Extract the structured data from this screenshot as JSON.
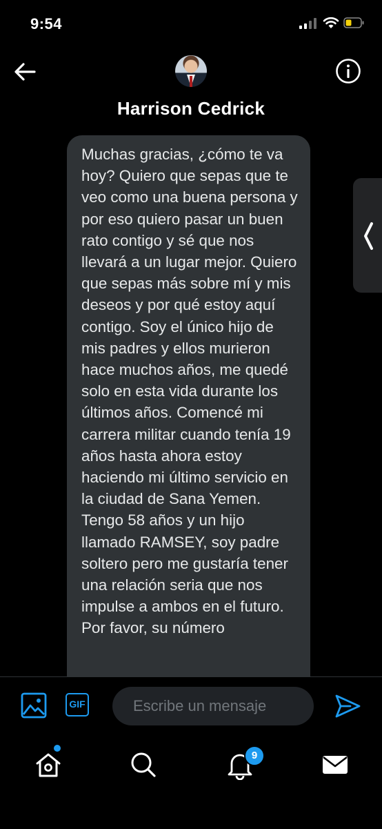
{
  "status_bar": {
    "time": "9:54",
    "icons": [
      "cellular-signal-icon",
      "wifi-icon",
      "battery-icon"
    ],
    "battery_color": "#f5d20a"
  },
  "header": {
    "back_icon": "arrow-left-icon",
    "contact_name": "Harrison Cedrick",
    "info_icon": "info-circle-icon"
  },
  "message": {
    "text": "Muchas gracias, ¿cómo te va hoy? Quiero que sepas que te veo como una buena persona y por eso quiero pasar un buen rato contigo y sé que nos llevará a un lugar mejor. Quiero que sepas más sobre mí y mis deseos y por qué estoy aquí contigo. Soy el único hijo de mis padres y ellos murieron hace muchos años, me quedé solo en esta vida durante los últimos años. Comencé mi carrera militar cuando tenía 19 años hasta ahora estoy haciendo mi último servicio en la ciudad de Sana Yemen. Tengo 58 años y un hijo llamado RAMSEY, soy padre soltero pero me gustaría tener una relación seria que nos impulse a ambos en el futuro. Por favor, su número"
  },
  "composer": {
    "gif_label": "GIF",
    "placeholder": "Escribe un mensaje",
    "value": ""
  },
  "tab_bar": {
    "notifications_count": "9"
  },
  "colors": {
    "accent": "#1d9bf0",
    "background": "#000000",
    "bubble": "#2f3336"
  }
}
